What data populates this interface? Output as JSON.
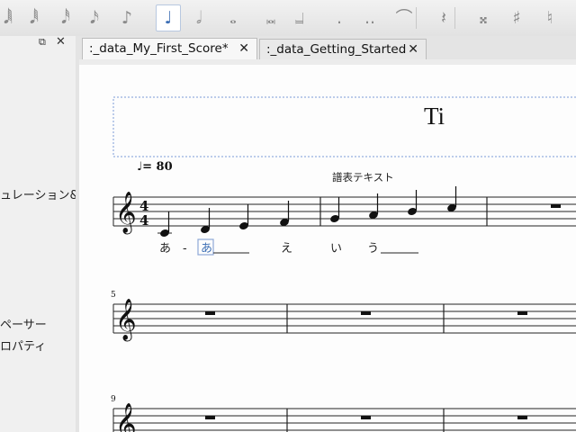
{
  "toolbar": {
    "icons": [
      {
        "name": "64th-note-icon",
        "glyph": "𝅘𝅥𝅲"
      },
      {
        "name": "32nd-note-icon",
        "glyph": "𝅘𝅥𝅱"
      },
      {
        "name": "16th-note-icon",
        "glyph": "𝅘𝅥𝅰"
      },
      {
        "name": "eighth-note-icon",
        "glyph": "𝅘𝅥𝅯"
      },
      {
        "name": "eighth-note-alt-icon",
        "glyph": "♪"
      },
      {
        "name": "quarter-note-icon",
        "glyph": "♩",
        "active": true
      },
      {
        "name": "half-note-icon",
        "glyph": "𝅗𝅥"
      },
      {
        "name": "whole-note-icon",
        "glyph": "𝅝"
      },
      {
        "name": "double-whole-note-icon",
        "glyph": "𝅜"
      },
      {
        "name": "longa-note-icon",
        "glyph": "𝆶"
      },
      {
        "name": "augmentation-dot-icon",
        "glyph": "."
      },
      {
        "name": "double-dot-icon",
        "glyph": ".."
      },
      {
        "name": "tie-icon",
        "glyph": "⌒"
      },
      {
        "name": "rest-icon",
        "glyph": "𝄽"
      },
      {
        "name": "double-sharp-icon",
        "glyph": "𝄪"
      },
      {
        "name": "sharp-icon",
        "glyph": "♯"
      },
      {
        "name": "natural-icon",
        "glyph": "♮"
      }
    ]
  },
  "left_panel": {
    "item1": "ュレーション&",
    "item2": "ペーサー",
    "item3": "ロパティ"
  },
  "tabs": [
    {
      "label": ":_data_My_First_Score*",
      "close": "✕"
    },
    {
      "label": ":_data_Getting_Started",
      "close": "✕"
    }
  ],
  "score": {
    "title": "Ti",
    "tempo_marking": "♩= 80",
    "staff_text": "譜表テキスト",
    "time_signature": {
      "numerator": "4",
      "denominator": "4"
    },
    "lyrics": [
      "あ",
      "-",
      "あ",
      "え",
      "い",
      "う"
    ],
    "measure_numbers": [
      "5",
      "9"
    ]
  },
  "colors": {
    "accent": "#3d6fb5",
    "selection": "#8fa8d8"
  }
}
